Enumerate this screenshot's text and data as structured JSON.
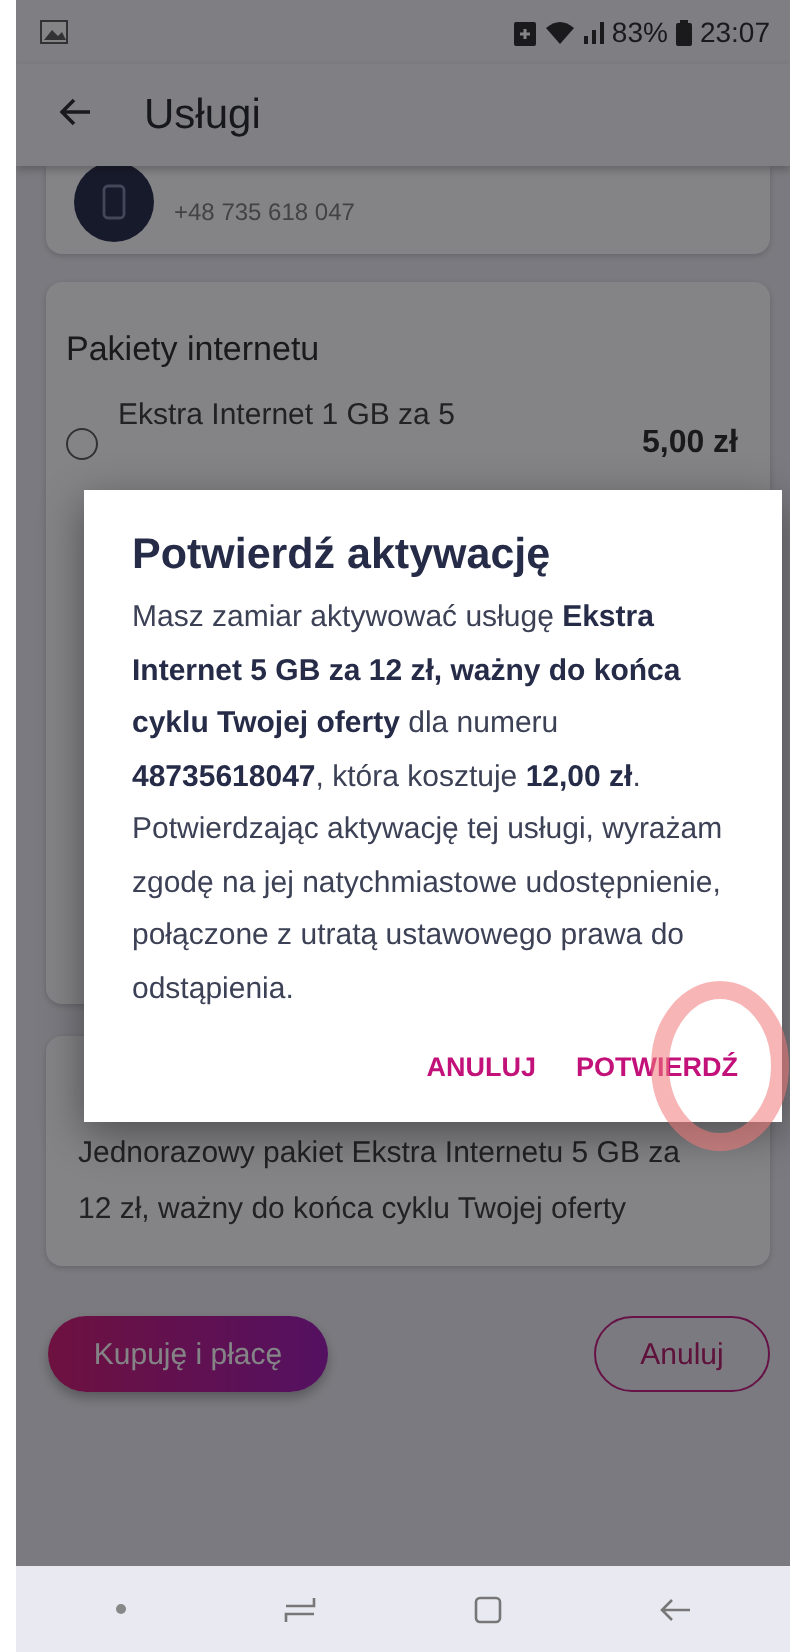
{
  "status_bar": {
    "battery": "83%",
    "time": "23:07"
  },
  "app_bar": {
    "title": "Usługi"
  },
  "phone_card": {
    "number": "+48 735 618 047"
  },
  "packages_card": {
    "title": "Pakiety internetu",
    "items": [
      {
        "label": "Ekstra Internet 1 GB za 5",
        "price": "5,00 zł",
        "selected": false
      }
    ]
  },
  "description_card": {
    "text": "Jednorazowy pakiet Ekstra Internetu 5 GB za 12 zł, ważny do końca cyklu Twojej oferty"
  },
  "actions": [
    {
      "label": "Kupuję i płacę",
      "kind": "primary"
    },
    {
      "label": "Anuluj",
      "kind": "outline"
    }
  ],
  "dialog": {
    "title": "Potwierdź aktywację",
    "message": "Masz zamiar aktywować usługę **Ekstra Internet 5 GB za 12 zł, ważny do końca cyklu Twojej oferty** dla numeru **48735618047**, która kosztuje **12,00 zł**. Potwierdzając aktywację tej usługi, wyrażam zgodę na jej natychmiastowe udostępnienie, połączone z utratą ustawowego prawa do odstąpienia.",
    "buttons": [
      {
        "label": "ANULUJ"
      },
      {
        "label": "POTWIERDŹ"
      }
    ]
  }
}
